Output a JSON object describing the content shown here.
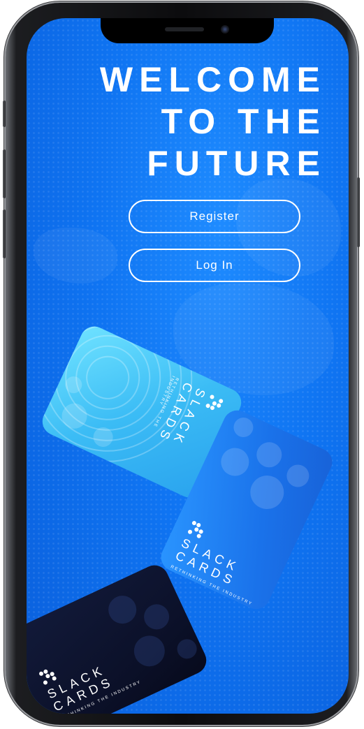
{
  "headline": {
    "line1": "WELCOME",
    "line2": "TO THE",
    "line3": "FUTURE"
  },
  "buttons": {
    "register": "Register",
    "login": "Log In"
  },
  "cards": [
    {
      "name_line1": "SLACK",
      "name_line2": "CARDS",
      "tagline": "RETHINKING THE INDUSTRY",
      "theme": "cyan"
    },
    {
      "name_line1": "SLACK",
      "name_line2": "CARDS",
      "tagline": "RETHINKING THE INDUSTRY",
      "theme": "blue"
    },
    {
      "name_line1": "SLACK",
      "name_line2": "CARDS",
      "tagline": "RETHINKING THE INDUSTRY",
      "theme": "dark"
    }
  ],
  "colors": {
    "background_blue": "#0f74f2",
    "accent_cyan": "#3bbcf5",
    "card_dark": "#0b1028",
    "text": "#ffffff"
  }
}
